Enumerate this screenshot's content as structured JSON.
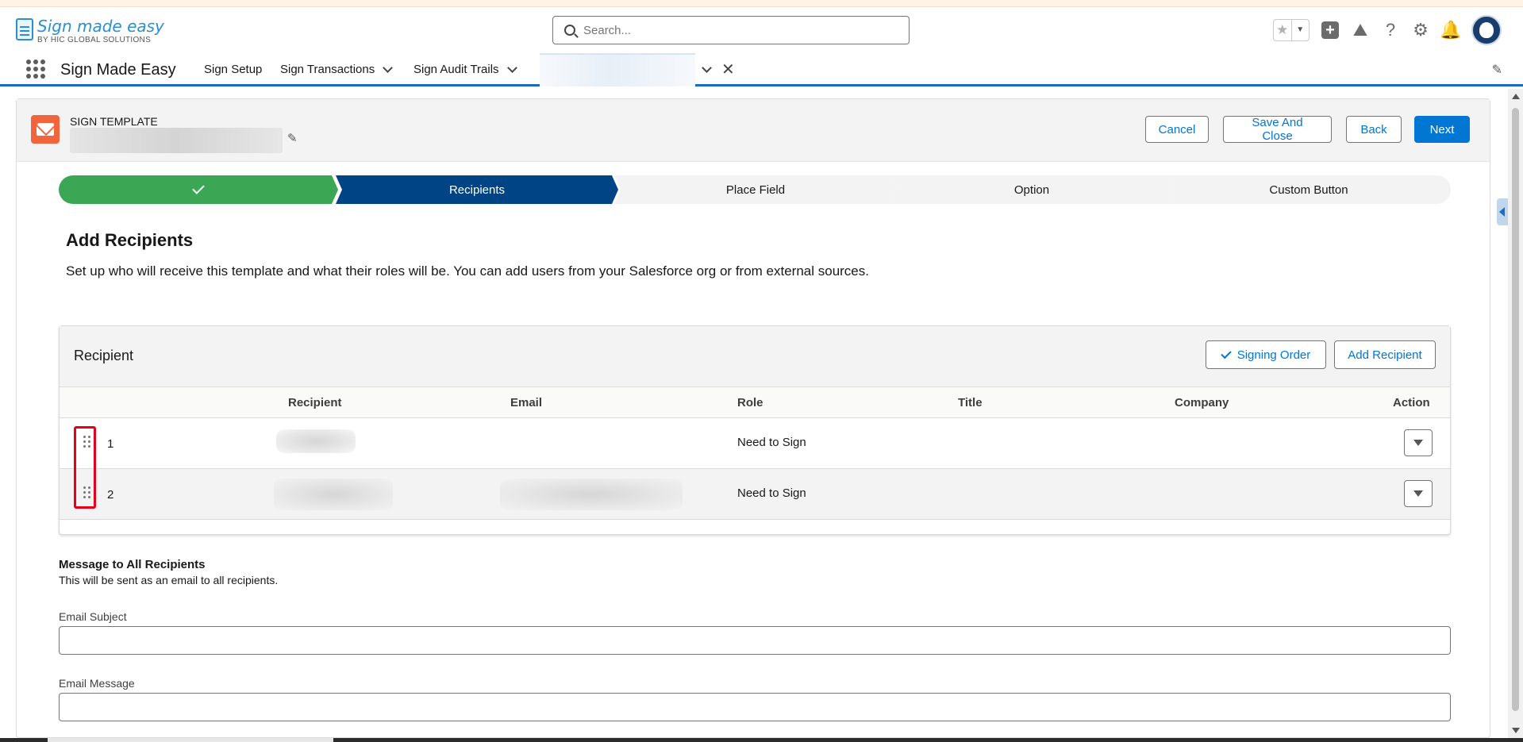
{
  "header": {
    "logo_main": "Sign made easy",
    "logo_sub": "BY HIC GLOBAL SOLUTIONS",
    "search_placeholder": "Search..."
  },
  "nav": {
    "app_name": "Sign Made Easy",
    "items": [
      {
        "label": "Sign Setup"
      },
      {
        "label": "Sign Transactions"
      },
      {
        "label": "Sign Audit Trails"
      }
    ]
  },
  "page_header": {
    "eyebrow": "SIGN TEMPLATE",
    "buttons": {
      "cancel": "Cancel",
      "save_close": "Save And Close",
      "back": "Back",
      "next": "Next"
    }
  },
  "path": {
    "steps": [
      {
        "label": "",
        "state": "complete"
      },
      {
        "label": "Recipients",
        "state": "current"
      },
      {
        "label": "Place Field",
        "state": "incomplete"
      },
      {
        "label": "Option",
        "state": "incomplete"
      },
      {
        "label": "Custom Button",
        "state": "incomplete"
      }
    ]
  },
  "section": {
    "title": "Add Recipients",
    "description": "Set up who will receive this template and what their roles will be. You can add users from your Salesforce org or from external sources."
  },
  "recipients_card": {
    "title": "Recipient",
    "signing_order_label": "Signing Order",
    "add_recipient_label": "Add Recipient",
    "columns": [
      "Recipient",
      "Email",
      "Role",
      "Title",
      "Company",
      "Action"
    ],
    "rows": [
      {
        "order": "1",
        "role": "Need to Sign"
      },
      {
        "order": "2",
        "role": "Need to Sign"
      }
    ]
  },
  "message": {
    "title": "Message to All Recipients",
    "description": "This will be sent as an email to all recipients.",
    "subject_label": "Email Subject",
    "subject_value": "",
    "message_label": "Email Message",
    "message_value": ""
  },
  "colors": {
    "brand": "#0176d3",
    "path_complete": "#3ba755",
    "path_current": "#014486",
    "template_icon": "#f2643b",
    "highlight": "#e6001b"
  },
  "icons": [
    "search-icon",
    "star-icon",
    "plus-icon",
    "trailhead-icon",
    "help-icon",
    "gear-icon",
    "bell-icon",
    "avatar",
    "app-launcher-icon",
    "chevron-down-icon",
    "close-icon",
    "pencil-icon",
    "envelope-icon",
    "check-icon",
    "drag-handle-icon",
    "dropdown-icon"
  ]
}
